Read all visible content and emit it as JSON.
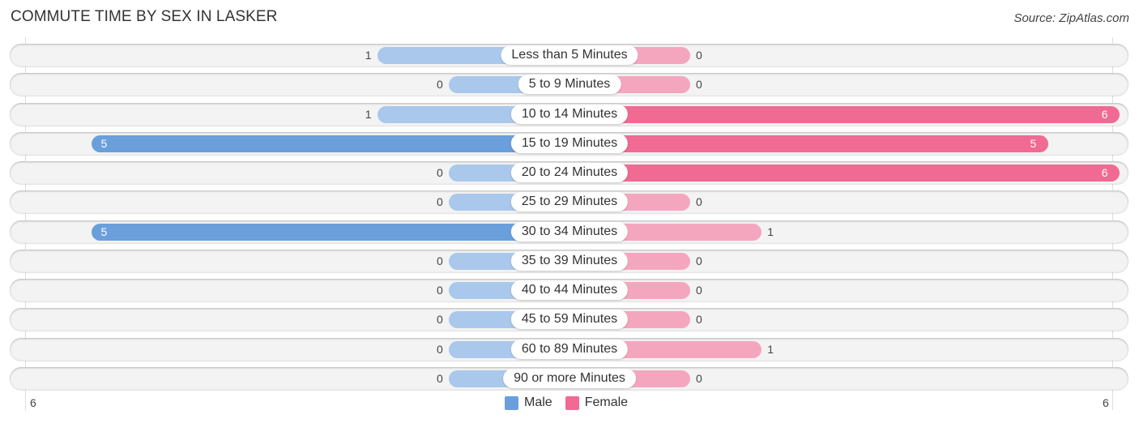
{
  "chart_data": {
    "type": "bar",
    "orientation": "horizontal-diverging",
    "title": "COMMUTE TIME BY SEX IN LASKER",
    "source": "Source: ZipAtlas.com",
    "categories": [
      "Less than 5 Minutes",
      "5 to 9 Minutes",
      "10 to 14 Minutes",
      "15 to 19 Minutes",
      "20 to 24 Minutes",
      "25 to 29 Minutes",
      "30 to 34 Minutes",
      "35 to 39 Minutes",
      "40 to 44 Minutes",
      "45 to 59 Minutes",
      "60 to 89 Minutes",
      "90 or more Minutes"
    ],
    "series": [
      {
        "name": "Male",
        "color": "#6a9fdc",
        "values": [
          1,
          0,
          1,
          5,
          0,
          0,
          5,
          0,
          0,
          0,
          0,
          0
        ]
      },
      {
        "name": "Female",
        "color": "#f06a94",
        "values": [
          0,
          0,
          6,
          5,
          6,
          0,
          1,
          0,
          0,
          0,
          1,
          0
        ]
      }
    ],
    "axis": {
      "left_label": "6",
      "right_label": "6",
      "max": 6
    },
    "legend": {
      "placement": "bottom-center",
      "entries": [
        "Male",
        "Female"
      ]
    }
  }
}
